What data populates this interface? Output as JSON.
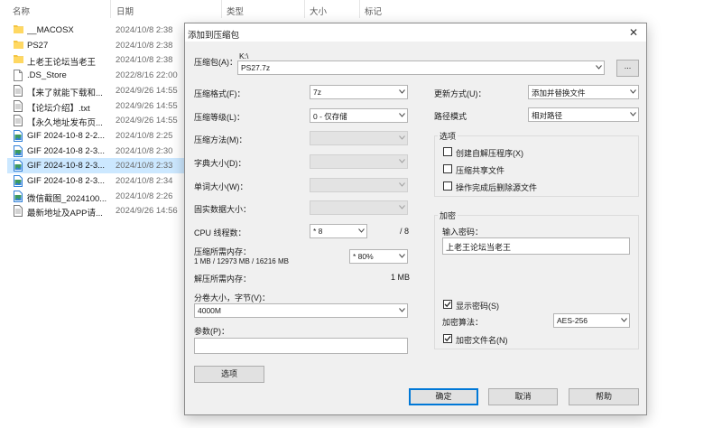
{
  "explorer": {
    "headers": {
      "name": "名称",
      "date": "日期",
      "type": "类型",
      "size": "大小",
      "tags": "标记"
    },
    "files": [
      {
        "name": "__MACOSX",
        "date": "2024/10/8 2:38",
        "icon": "folder-icon"
      },
      {
        "name": "PS27",
        "date": "2024/10/8 2:38",
        "icon": "folder-icon"
      },
      {
        "name": "上老王论坛当老王",
        "date": "2024/10/8 2:38",
        "icon": "folder-icon"
      },
      {
        "name": ".DS_Store",
        "date": "2022/8/16 22:00",
        "icon": "file-icon"
      },
      {
        "name": "【来了就能下载和...",
        "date": "2024/9/26 14:55",
        "icon": "document-icon"
      },
      {
        "name": "【论坛介绍】.txt",
        "date": "2024/9/26 14:55",
        "icon": "document-icon"
      },
      {
        "name": "【永久地址发布页...",
        "date": "2024/9/26 14:55",
        "icon": "document-icon"
      },
      {
        "name": "GIF 2024-10-8 2-2...",
        "date": "2024/10/8 2:25",
        "icon": "image-icon"
      },
      {
        "name": "GIF 2024-10-8 2-3...",
        "date": "2024/10/8 2:30",
        "icon": "image-icon"
      },
      {
        "name": "GIF 2024-10-8 2-3...",
        "date": "2024/10/8 2:33",
        "icon": "image-icon",
        "selected": true
      },
      {
        "name": "GIF 2024-10-8 2-3...",
        "date": "2024/10/8 2:34",
        "icon": "image-icon"
      },
      {
        "name": "微信截图_2024100...",
        "date": "2024/10/8 2:26",
        "icon": "image-icon"
      },
      {
        "name": "最新地址及APP请...",
        "date": "2024/9/26 14:56",
        "icon": "document-icon"
      }
    ]
  },
  "dialog": {
    "title": "添加到压缩包",
    "close_glyph": "✕",
    "archive_label": "压缩包(A)：",
    "archive_path": "K:\\",
    "archive_name": "PS27.7z",
    "browse_label": "...",
    "format_label": "压缩格式(F)：",
    "format_value": "7z",
    "level_label": "压缩等级(L)：",
    "level_value": "0 - 仅存储",
    "method_label": "压缩方法(M)：",
    "dict_label": "字典大小(D)：",
    "word_label": "单词大小(W)：",
    "solid_label": "固实数据大小：",
    "cpu_label": "CPU 线程数：",
    "cpu_value": "* 8",
    "cpu_max": "/ 8",
    "mem_label": "压缩所需内存：",
    "mem_detail": "1 MB / 12973 MB / 16216 MB",
    "mem_percent": "* 80%",
    "decomp_label": "解压所需内存：",
    "decomp_value": "1 MB",
    "split_label": "分卷大小，字节(V)：",
    "split_value": "4000M",
    "params_label": "参数(P)：",
    "params_value": "",
    "options_button": "选项",
    "update_label": "更新方式(U)：",
    "update_value": "添加并替换文件",
    "path_label": "路径模式",
    "path_value": "相对路径",
    "options_group": "选项",
    "opt_sfx": "创建自解压程序(X)",
    "opt_shared": "压缩共享文件",
    "opt_delete": "操作完成后删除源文件",
    "encrypt_group": "加密",
    "password_label": "输入密码：",
    "password_value": "上老王论坛当老王",
    "show_password": "显示密码(S)",
    "enc_method_label": "加密算法：",
    "enc_method_value": "AES-256",
    "enc_names": "加密文件名(N)",
    "ok": "确定",
    "cancel": "取消",
    "help": "帮助",
    "checks": {
      "sfx": false,
      "shared": false,
      "delete": false,
      "show_password": true,
      "enc_names": true
    }
  }
}
